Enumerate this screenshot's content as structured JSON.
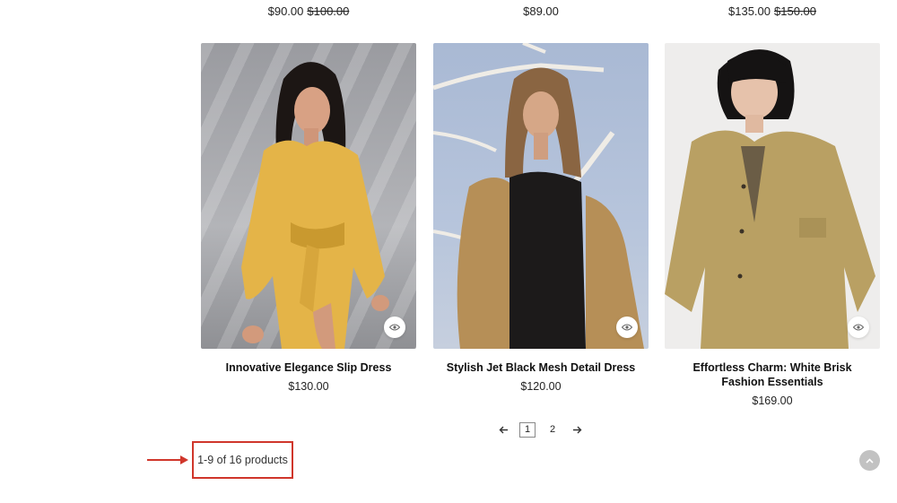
{
  "previous_row": {
    "prices": [
      {
        "current": "$90.00",
        "old": "$100.00"
      },
      {
        "current": "$89.00",
        "old": ""
      },
      {
        "current": "$135.00",
        "old": "$150.00"
      }
    ]
  },
  "products": [
    {
      "title": "Innovative Elegance Slip Dress",
      "price": "$130.00"
    },
    {
      "title": "Stylish Jet Black Mesh Detail Dress",
      "price": "$120.00"
    },
    {
      "title": "Effortless Charm: White Brisk Fashion Essentials",
      "price": "$169.00"
    }
  ],
  "pagination": {
    "pages": [
      "1",
      "2"
    ],
    "current": "1"
  },
  "results_count": "1-9 of 16 products",
  "colors": {
    "highlight": "#d0362b",
    "back_to_top": "#c2c2c2"
  },
  "icons": {
    "quick_view": "eye-icon",
    "prev": "arrow-left-icon",
    "next": "arrow-right-icon",
    "back_to_top": "chevron-up-icon",
    "annotation": "red-arrow-icon"
  }
}
